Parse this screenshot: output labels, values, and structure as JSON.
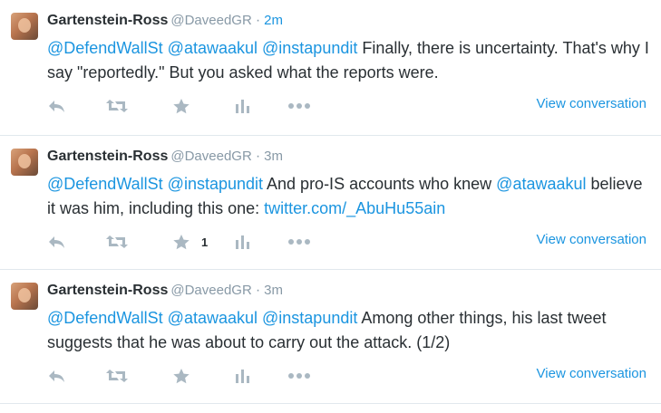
{
  "tweets": [
    {
      "fullname": "Gartenstein-Ross",
      "username": "@DaveedGR",
      "time": "2m",
      "time_color": "#1b95e0",
      "parts": [
        {
          "t": "@DefendWallSt",
          "k": "mention"
        },
        {
          "t": " "
        },
        {
          "t": "@atawaakul",
          "k": "mention"
        },
        {
          "t": " "
        },
        {
          "t": "@instapundit",
          "k": "mention"
        },
        {
          "t": " Finally, there is uncertainty. That's why I say \"reportedly.\" But you asked what the reports were."
        }
      ],
      "favorite_count": "",
      "view_conversation": "View conversation"
    },
    {
      "fullname": "Gartenstein-Ross",
      "username": "@DaveedGR",
      "time": "3m",
      "time_color": "#8899a6",
      "parts": [
        {
          "t": "@DefendWallSt",
          "k": "mention"
        },
        {
          "t": " "
        },
        {
          "t": "@instapundit",
          "k": "mention"
        },
        {
          "t": " And pro-IS accounts who knew "
        },
        {
          "t": "@atawaakul",
          "k": "mention"
        },
        {
          "t": " believe it was him, including this one: "
        },
        {
          "t": "twitter.com/_AbuHu55ain",
          "k": "link"
        }
      ],
      "favorite_count": "1",
      "view_conversation": "View conversation"
    },
    {
      "fullname": "Gartenstein-Ross",
      "username": "@DaveedGR",
      "time": "3m",
      "time_color": "#8899a6",
      "parts": [
        {
          "t": "@DefendWallSt",
          "k": "mention"
        },
        {
          "t": " "
        },
        {
          "t": "@atawaakul",
          "k": "mention"
        },
        {
          "t": " "
        },
        {
          "t": "@instapundit",
          "k": "mention"
        },
        {
          "t": " Among other things, his last tweet suggests that he was about to carry out the attack. (1/2)"
        }
      ],
      "favorite_count": "",
      "view_conversation": "View conversation"
    }
  ],
  "icons": {
    "reply": "reply-icon",
    "retweet": "retweet-icon",
    "favorite": "star-icon",
    "analytics": "bar-chart-icon",
    "more": "more-dots-icon"
  },
  "colors": {
    "link": "#1b95e0",
    "text": "#292f33",
    "muted": "#8899a6",
    "icon": "#aab8c2",
    "divider": "#e1e8ed"
  }
}
